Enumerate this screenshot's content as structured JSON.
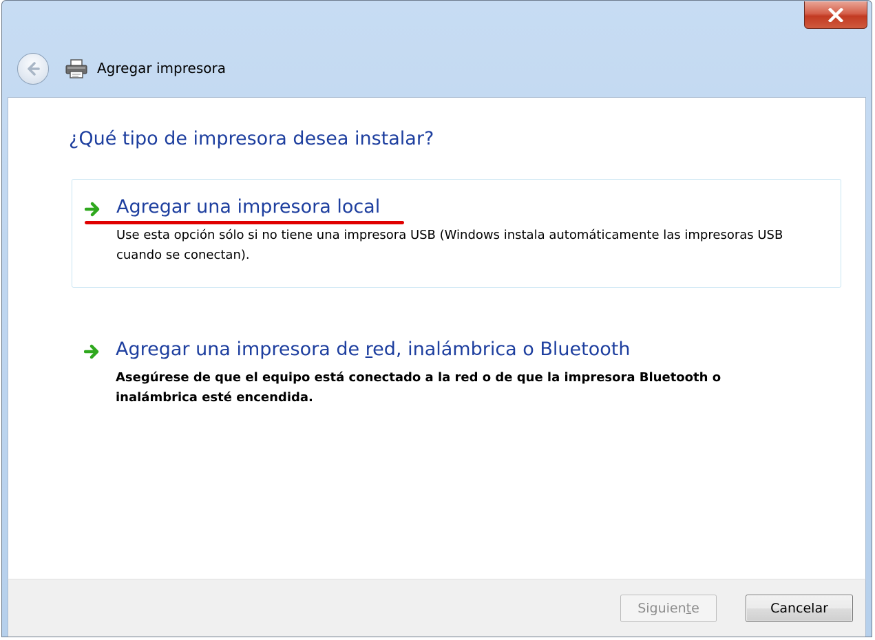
{
  "window": {
    "title": "Agregar impresora",
    "icons": {
      "close": "close-icon",
      "back": "back-arrow-icon",
      "app": "printer-icon"
    }
  },
  "content": {
    "question": "¿Qué tipo de impresora desea instalar?",
    "options": [
      {
        "title": "Agregar una impresora local",
        "description": "Use esta opción sólo si no tiene una impresora USB (Windows instala automáticamente las impresoras USB cuando se conectan).",
        "icon": "green-arrow-icon",
        "selected": true
      },
      {
        "title_before": "Agregar una impresora de ",
        "title_mnemonic": "r",
        "title_after": "ed, inalámbrica o Bluetooth",
        "description": "Asegúrese de que el equipo está conectado a la red o de que la impresora Bluetooth o inalámbrica esté encendida.",
        "icon": "green-arrow-icon",
        "selected": false
      }
    ]
  },
  "footer": {
    "next_before": "Siguien",
    "next_mnemonic": "t",
    "next_after": "e",
    "next_enabled": false,
    "cancel_label": "Cancelar"
  },
  "colors": {
    "heading_blue": "#1e3f9f",
    "highlight_red": "#e00000",
    "arrow_green": "#2fa81e"
  }
}
